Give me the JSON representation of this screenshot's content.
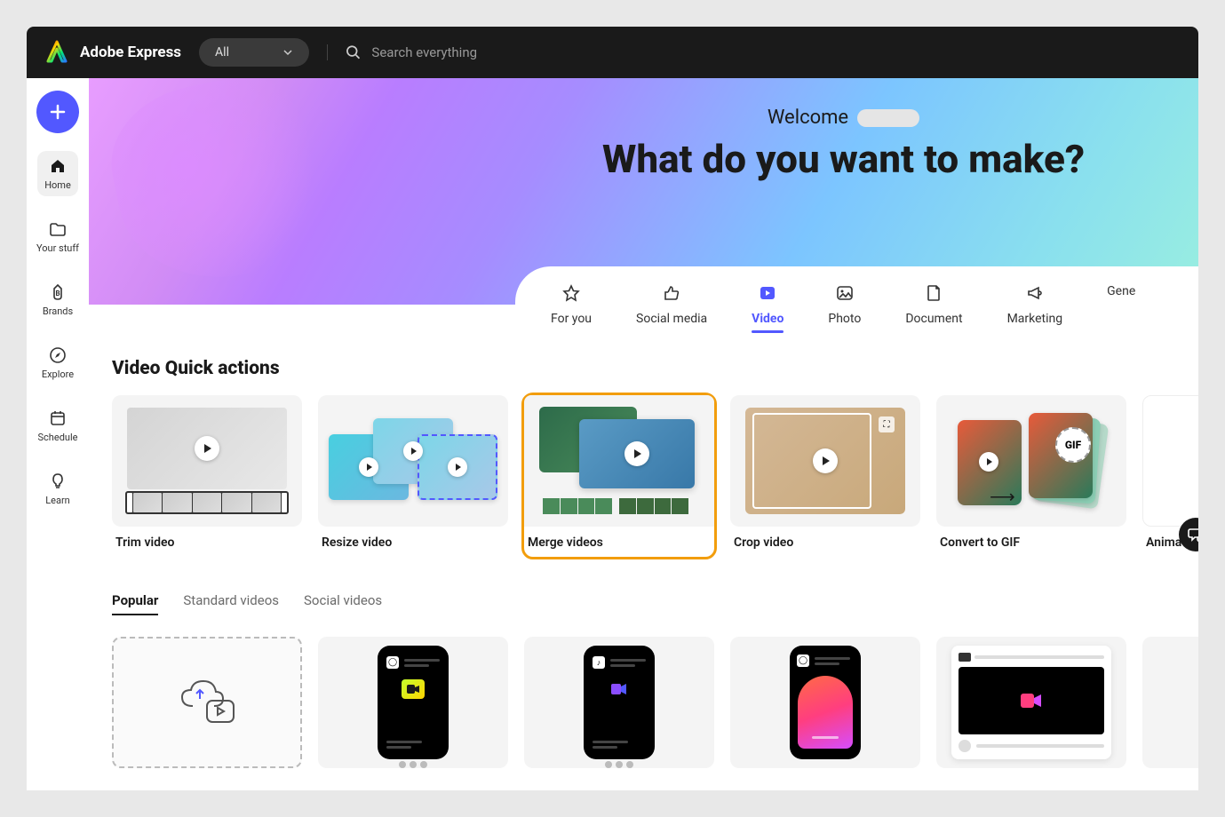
{
  "header": {
    "app_name": "Adobe Express",
    "dropdown_label": "All",
    "search_placeholder": "Search everything"
  },
  "sidebar": {
    "items": [
      {
        "label": "Home",
        "icon": "home",
        "active": true
      },
      {
        "label": "Your stuff",
        "icon": "folder"
      },
      {
        "label": "Brands",
        "icon": "brand"
      },
      {
        "label": "Explore",
        "icon": "compass"
      },
      {
        "label": "Schedule",
        "icon": "calendar"
      },
      {
        "label": "Learn",
        "icon": "bulb"
      }
    ]
  },
  "hero": {
    "welcome": "Welcome",
    "title": "What do you want to make?"
  },
  "category_tabs": [
    {
      "label": "For you",
      "icon": "star"
    },
    {
      "label": "Social media",
      "icon": "thumbs-up"
    },
    {
      "label": "Video",
      "icon": "play-square",
      "selected": true
    },
    {
      "label": "Photo",
      "icon": "image"
    },
    {
      "label": "Document",
      "icon": "file"
    },
    {
      "label": "Marketing",
      "icon": "megaphone"
    },
    {
      "label": "Gene",
      "icon": ""
    }
  ],
  "quick_actions": {
    "section_title": "Video Quick actions",
    "items": [
      {
        "label": "Trim video",
        "thumb": "trim"
      },
      {
        "label": "Resize video",
        "thumb": "resize"
      },
      {
        "label": "Merge videos",
        "thumb": "merge",
        "highlighted": true
      },
      {
        "label": "Crop video",
        "thumb": "crop"
      },
      {
        "label": "Convert to GIF",
        "thumb": "gif",
        "badge": "GIF"
      },
      {
        "label": "Animate fro",
        "thumb": "animate"
      }
    ]
  },
  "filter_tabs": [
    {
      "label": "Popular",
      "selected": true
    },
    {
      "label": "Standard videos"
    },
    {
      "label": "Social videos"
    }
  ],
  "templates": [
    {
      "type": "upload"
    },
    {
      "type": "instagram-video"
    },
    {
      "type": "tiktok-video"
    },
    {
      "type": "instagram-reel"
    },
    {
      "type": "youtube-video"
    },
    {
      "type": "video-generic"
    }
  ]
}
